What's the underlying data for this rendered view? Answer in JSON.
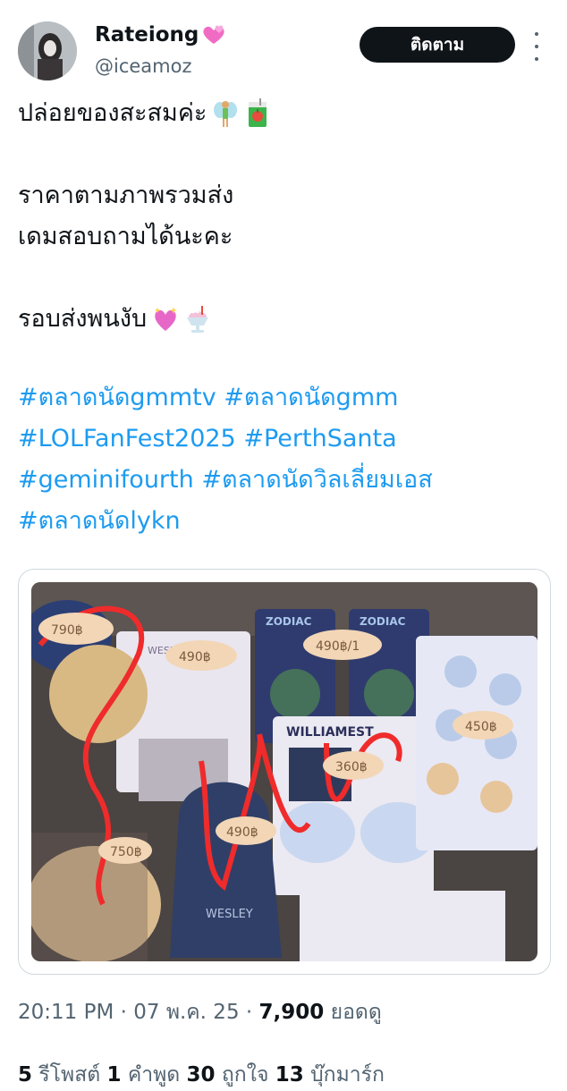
{
  "author": {
    "display_name": "Rateiong",
    "handle": "@iceamoz",
    "avatar_icon": "avatar-photo"
  },
  "actions": {
    "follow_label": "ติดตาม",
    "more_icon": "more-vertical-icon"
  },
  "tweet": {
    "line1": "ปล่อยของสะสมค่ะ",
    "line2": "ราคาตามภาพรวมส่ง",
    "line3": "เดมสอบถามได้นะคะ",
    "line4": "รอบส่งพนงับ",
    "hashtags": [
      [
        "#ตลาดนัดgmmtv",
        "#ตลาดนัดgmm"
      ],
      [
        "#LOLFanFest2025",
        "#PerthSanta"
      ],
      [
        "#geminifourth",
        "#ตลาดนัดวิลเลี่ยมเอส"
      ],
      [
        "#ตลาดนัดlykn"
      ]
    ]
  },
  "photo": {
    "price_tags": [
      "790฿",
      "490฿",
      "490฿/1",
      "450฿",
      "360฿",
      "750฿",
      "490฿"
    ],
    "product_labels": [
      "ZODIAC",
      "ZODIAC",
      "WILLIAMEST",
      "WESLEY",
      "WESLEY"
    ]
  },
  "meta": {
    "time": "20:11 PM",
    "sep1": "·",
    "date": "07 พ.ค. 25",
    "sep2": "·",
    "views": "7,900",
    "views_label": "ยอดดู"
  },
  "stats": {
    "reposts": "5",
    "reposts_label": "รีโพสต์",
    "quotes": "1",
    "quotes_label": "คำพูด",
    "likes": "30",
    "likes_label": "ถูกใจ",
    "bookmarks": "13",
    "bookmarks_label": "บุ๊กมาร์ก"
  },
  "colors": {
    "link": "#1d9bf0",
    "text": "#0f1419",
    "muted": "#536471",
    "follow_bg": "#0f1419"
  }
}
